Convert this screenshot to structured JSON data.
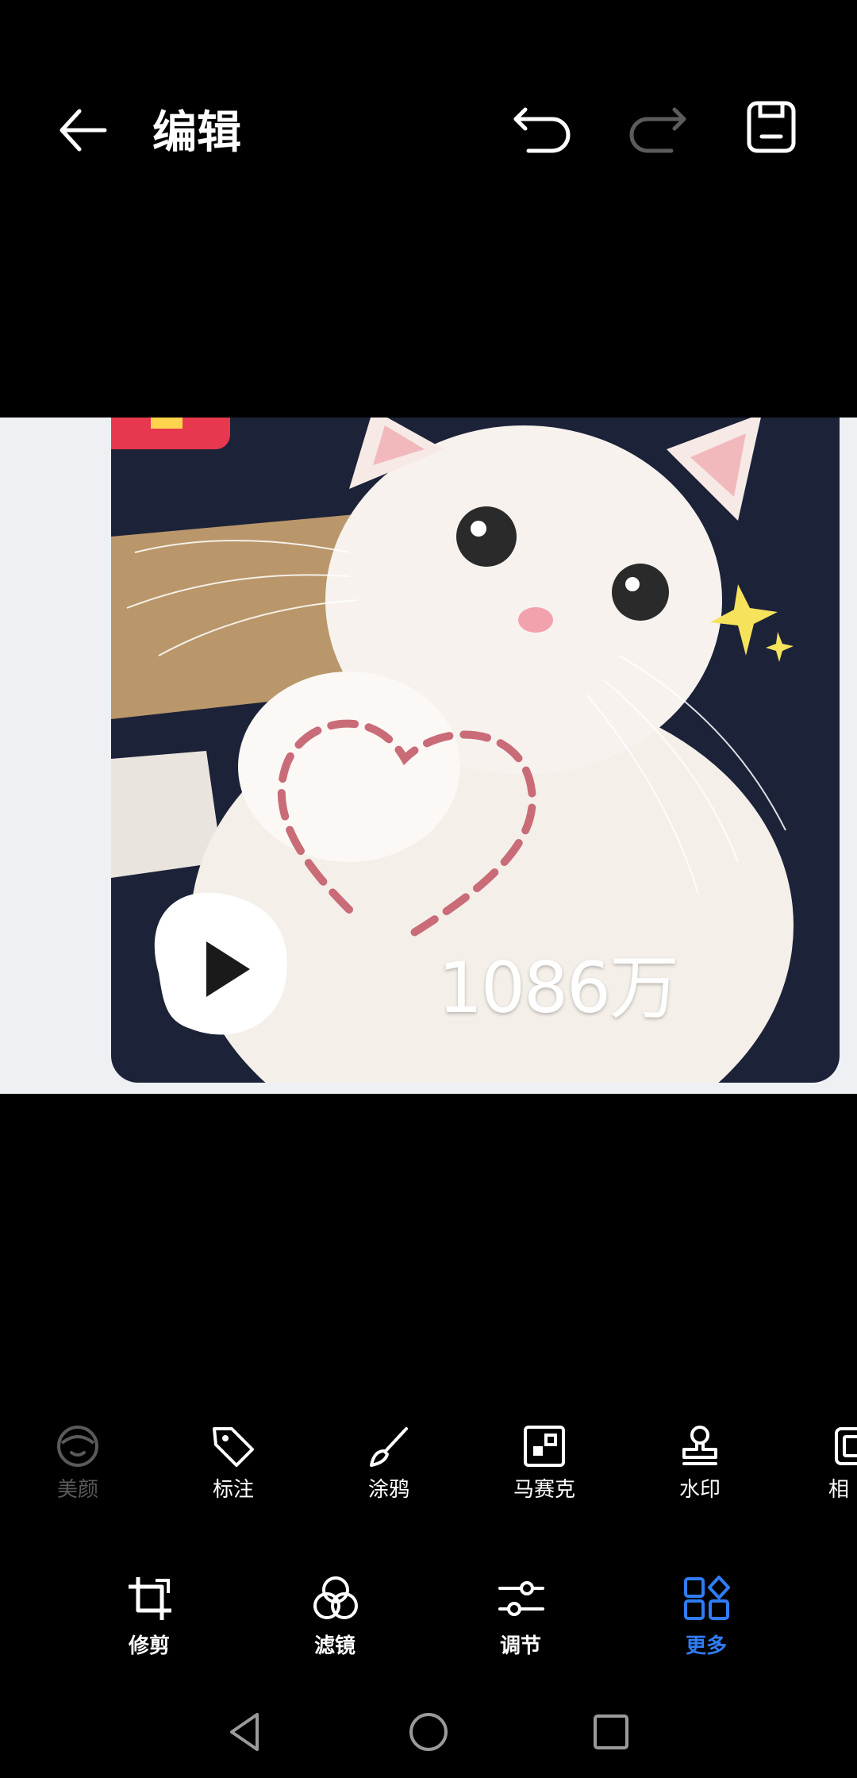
{
  "header": {
    "title": "编辑",
    "back_icon": "arrow-left-icon",
    "undo_icon": "undo-icon",
    "redo_icon": "redo-icon",
    "save_icon": "save-icon"
  },
  "image": {
    "overlay_text": "1086万"
  },
  "tools_row1": [
    {
      "label": "美颜",
      "icon": "beauty-face-icon",
      "enabled": false
    },
    {
      "label": "标注",
      "icon": "tag-icon",
      "enabled": true
    },
    {
      "label": "涂鸦",
      "icon": "brush-icon",
      "enabled": true
    },
    {
      "label": "马赛克",
      "icon": "mosaic-icon",
      "enabled": true
    },
    {
      "label": "水印",
      "icon": "stamp-icon",
      "enabled": true
    },
    {
      "label": "相",
      "icon": "frame-icon",
      "enabled": true
    }
  ],
  "tools_row2": [
    {
      "label": "修剪",
      "icon": "crop-icon",
      "active": false
    },
    {
      "label": "滤镜",
      "icon": "filter-icon",
      "active": false
    },
    {
      "label": "调节",
      "icon": "adjust-icon",
      "active": false
    },
    {
      "label": "更多",
      "icon": "more-grid-icon",
      "active": true
    }
  ],
  "colors": {
    "accent": "#2f7df6",
    "disabled": "#5a5a5a",
    "background": "#000000"
  },
  "navbar": [
    "nav-back-icon",
    "nav-home-icon",
    "nav-recents-icon"
  ]
}
